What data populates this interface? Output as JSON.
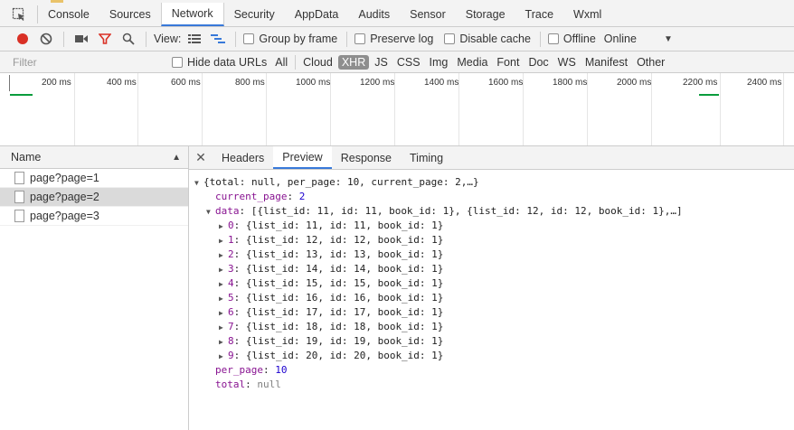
{
  "main_tabs": [
    {
      "label": "Console"
    },
    {
      "label": "Sources"
    },
    {
      "label": "Network",
      "active": true
    },
    {
      "label": "Security"
    },
    {
      "label": "AppData"
    },
    {
      "label": "Audits"
    },
    {
      "label": "Sensor"
    },
    {
      "label": "Storage"
    },
    {
      "label": "Trace"
    },
    {
      "label": "Wxml"
    }
  ],
  "toolbar": {
    "view_label": "View:",
    "group_by_frame": "Group by frame",
    "preserve_log": "Preserve log",
    "disable_cache": "Disable cache",
    "offline": "Offline",
    "throttle_value": "Online",
    "record_color": "#d93025",
    "filter_color": "#d93025"
  },
  "filterbar": {
    "placeholder": "Filter",
    "hide_data_urls": "Hide data URLs",
    "types": [
      "All",
      "Cloud",
      "XHR",
      "JS",
      "CSS",
      "Img",
      "Media",
      "Font",
      "Doc",
      "WS",
      "Manifest",
      "Other"
    ],
    "active_type": "XHR"
  },
  "timeline": {
    "ticks": [
      "200 ms",
      "400 ms",
      "600 ms",
      "800 ms",
      "1000 ms",
      "1200 ms",
      "1400 ms",
      "1600 ms",
      "1800 ms",
      "2000 ms",
      "2200 ms",
      "2400 ms"
    ],
    "bar_color": "#0a9c3c"
  },
  "requests": {
    "header": "Name",
    "items": [
      {
        "name": "page?page=1",
        "selected": false
      },
      {
        "name": "page?page=2",
        "selected": true
      },
      {
        "name": "page?page=3",
        "selected": false
      }
    ]
  },
  "detail_tabs": [
    {
      "label": "Headers"
    },
    {
      "label": "Preview",
      "active": true
    },
    {
      "label": "Response"
    },
    {
      "label": "Timing"
    }
  ],
  "preview": {
    "summary": "{total: null, per_page: 10, current_page: 2,…}",
    "current_page_key": "current_page",
    "current_page_val": "2",
    "data_key": "data",
    "data_summary": "[{list_id: 11, id: 11, book_id: 1}, {list_id: 12, id: 12, book_id: 1},…]",
    "items": [
      {
        "index": "0",
        "text": "{list_id: 11, id: 11, book_id: 1}"
      },
      {
        "index": "1",
        "text": "{list_id: 12, id: 12, book_id: 1}"
      },
      {
        "index": "2",
        "text": "{list_id: 13, id: 13, book_id: 1}"
      },
      {
        "index": "3",
        "text": "{list_id: 14, id: 14, book_id: 1}"
      },
      {
        "index": "4",
        "text": "{list_id: 15, id: 15, book_id: 1}"
      },
      {
        "index": "5",
        "text": "{list_id: 16, id: 16, book_id: 1}"
      },
      {
        "index": "6",
        "text": "{list_id: 17, id: 17, book_id: 1}"
      },
      {
        "index": "7",
        "text": "{list_id: 18, id: 18, book_id: 1}"
      },
      {
        "index": "8",
        "text": "{list_id: 19, id: 19, book_id: 1}"
      },
      {
        "index": "9",
        "text": "{list_id: 20, id: 20, book_id: 1}"
      }
    ],
    "per_page_key": "per_page",
    "per_page_val": "10",
    "total_key": "total",
    "total_val": "null"
  }
}
